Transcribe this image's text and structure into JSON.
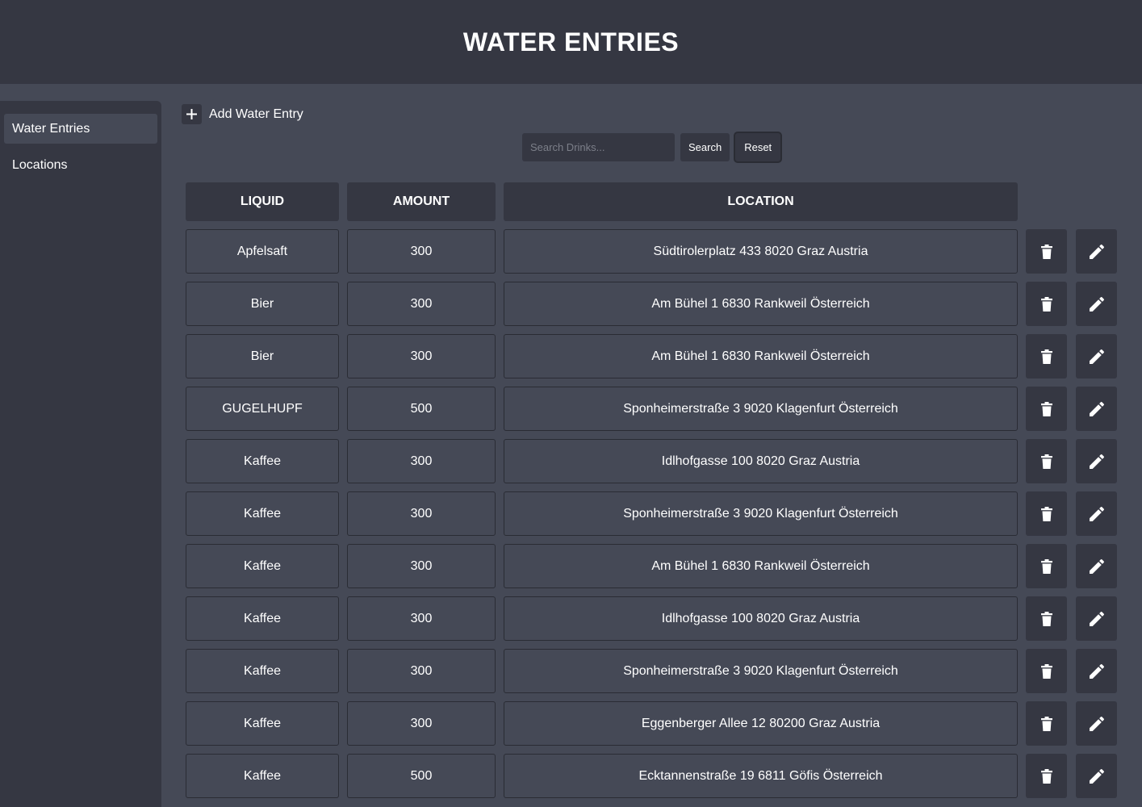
{
  "header": {
    "title": "WATER ENTRIES"
  },
  "sidebar": {
    "items": [
      {
        "label": "Water Entries",
        "active": true
      },
      {
        "label": "Locations",
        "active": false
      }
    ]
  },
  "toolbar": {
    "add_label": "Add Water Entry",
    "search_placeholder": "Search Drinks...",
    "search_label": "Search",
    "reset_label": "Reset"
  },
  "table": {
    "columns": [
      "LIQUID",
      "AMOUNT",
      "LOCATION"
    ],
    "rows": [
      {
        "liquid": "Apfelsaft",
        "amount": "300",
        "location": "Südtirolerplatz 433 8020 Graz Austria"
      },
      {
        "liquid": "Bier",
        "amount": "300",
        "location": "Am Bühel 1 6830 Rankweil Österreich"
      },
      {
        "liquid": "Bier",
        "amount": "300",
        "location": "Am Bühel 1 6830 Rankweil Österreich"
      },
      {
        "liquid": "GUGELHUPF",
        "amount": "500",
        "location": "Sponheimerstraße 3 9020 Klagenfurt Österreich"
      },
      {
        "liquid": "Kaffee",
        "amount": "300",
        "location": "Idlhofgasse 100 8020 Graz Austria"
      },
      {
        "liquid": "Kaffee",
        "amount": "300",
        "location": "Sponheimerstraße 3 9020 Klagenfurt Österreich"
      },
      {
        "liquid": "Kaffee",
        "amount": "300",
        "location": "Am Bühel 1 6830 Rankweil Österreich"
      },
      {
        "liquid": "Kaffee",
        "amount": "300",
        "location": "Idlhofgasse 100 8020 Graz Austria"
      },
      {
        "liquid": "Kaffee",
        "amount": "300",
        "location": "Sponheimerstraße 3 9020 Klagenfurt Österreich"
      },
      {
        "liquid": "Kaffee",
        "amount": "300",
        "location": "Eggenberger Allee 12 80200 Graz Austria"
      },
      {
        "liquid": "Kaffee",
        "amount": "500",
        "location": "Ecktannenstraße 19 6811 Göfis Österreich"
      }
    ],
    "row_icons": {
      "delete": "trash-icon",
      "edit": "pencil-icon"
    }
  },
  "colors": {
    "header_bg": "#353742",
    "page_bg": "#454956",
    "cell_border": "#2a2c34",
    "text": "#ffffff",
    "placeholder": "#7c7f89"
  }
}
